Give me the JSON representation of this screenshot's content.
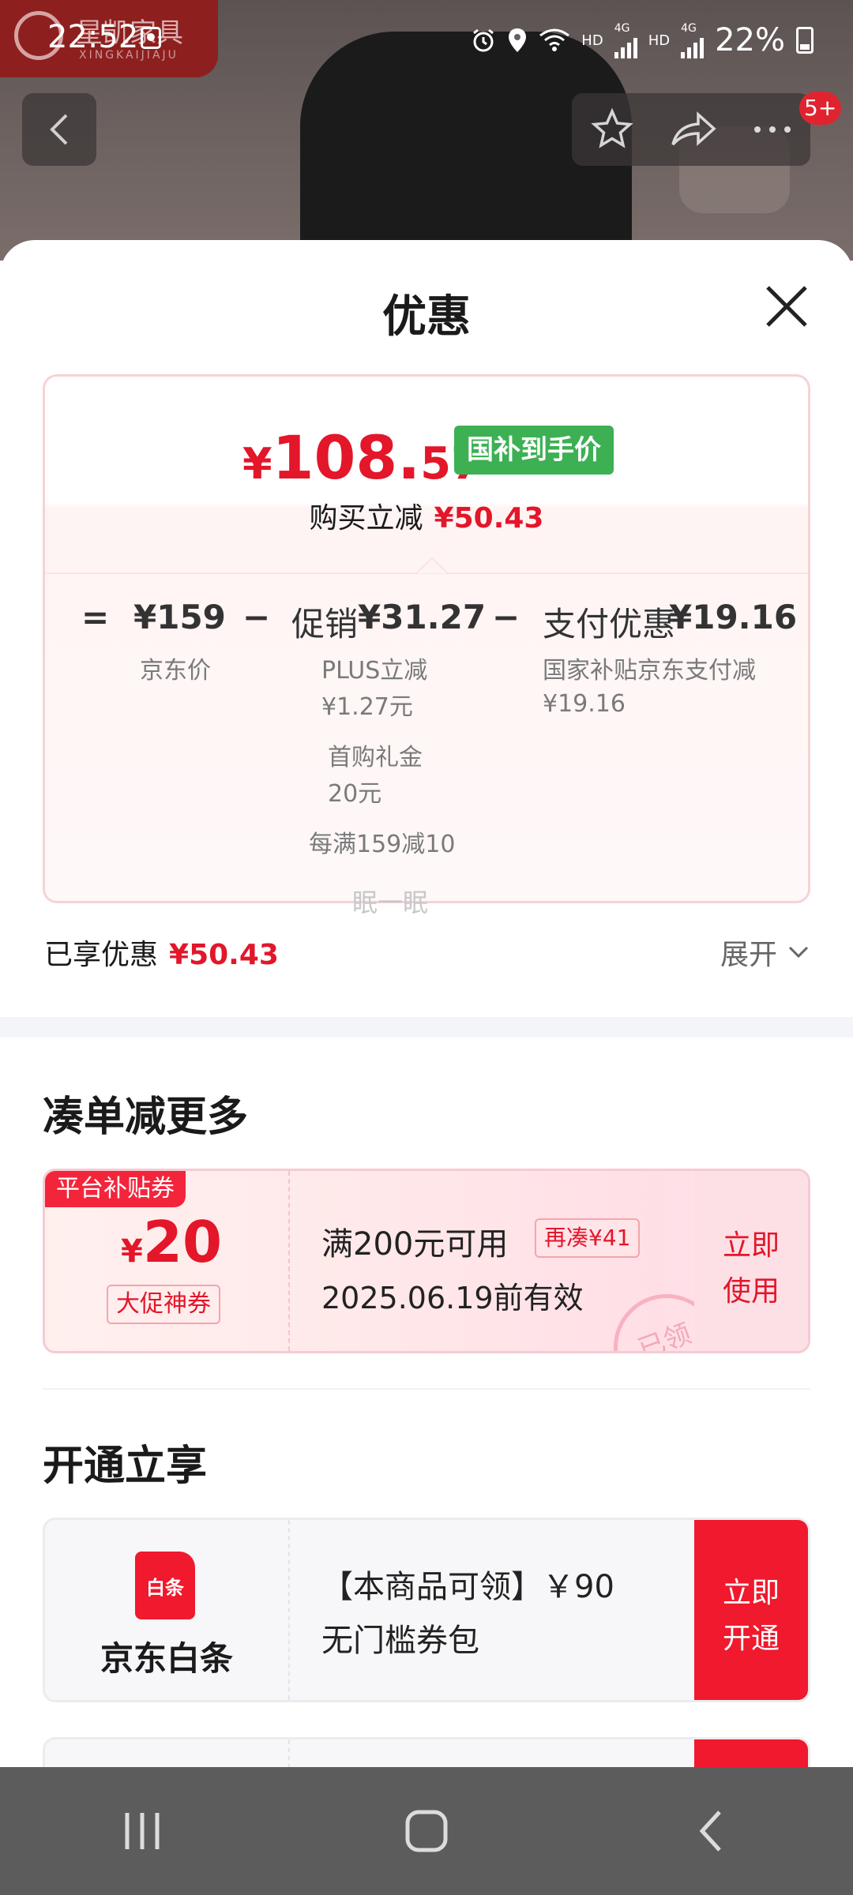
{
  "status_bar": {
    "time": "22:52",
    "net_1": "HD",
    "net_1_type": "4G",
    "net_2": "HD",
    "net_2_type": "4G",
    "battery": "22%"
  },
  "brand": {
    "name": "星凯家具",
    "sub": "XINGKAIJIAJU"
  },
  "nav": {
    "badge": "5+"
  },
  "sheet": {
    "title": "优惠"
  },
  "summary": {
    "price_yen": "¥",
    "price_int": "108.",
    "price_dec": "57",
    "price_tag": "国补到手价",
    "save_label": "购买立减",
    "save_amount": "¥50.43",
    "eq": "=",
    "jd_price": "¥159",
    "jd_price_label": "京东价",
    "minus1": "−",
    "promo_label": "促销",
    "promo_amount": "¥31.27",
    "promo_items": [
      "PLUS立减",
      "¥1.27元",
      "首购礼金",
      "20元",
      "每满159减10"
    ],
    "minus2": "−",
    "pay_label": "支付优惠",
    "pay_amount": "¥19.16",
    "pay_items": [
      "国家补贴京东支付减",
      "¥19.16"
    ]
  },
  "watermark": "眠一眠",
  "enjoyed": {
    "label": "已享优惠",
    "amount": "¥50.43",
    "expand": "展开"
  },
  "section_more": {
    "title": "凑单减更多"
  },
  "coupon": {
    "tag": "平台补贴券",
    "yen": "¥",
    "amount": "20",
    "kind": "大促神券",
    "condition": "满200元可用",
    "add_more": "再凑¥41",
    "valid": "2025.06.19前有效",
    "use_line1": "立即",
    "use_line2": "使用",
    "stamp": "已领"
  },
  "section_open": {
    "title": "开通立享"
  },
  "baitiao": {
    "logo_text": "白条",
    "name": "京东白条",
    "line1": "【本商品可领】￥90",
    "line2": "无门槛券包",
    "btn_line1": "立即",
    "btn_line2": "开通"
  },
  "colors": {
    "accent": "#e3162a",
    "green_tag": "#3db054",
    "sheet_bg": "#ffffff"
  }
}
